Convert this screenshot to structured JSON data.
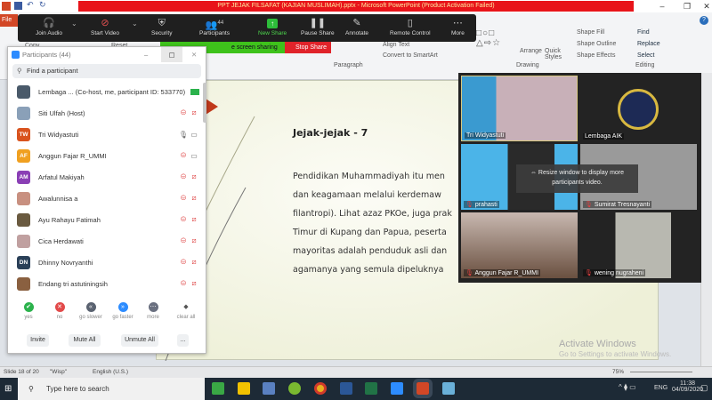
{
  "window": {
    "title": "PPT JEJAK FILSAFAT (KAJIAN MUSLIMAH).pptx - Microsoft PowerPoint (Product Activation Failed)",
    "file_tab": "File"
  },
  "ribbon": {
    "paragraph_label": "Paragraph",
    "drawing_label": "Drawing",
    "editing_label": "Editing",
    "align_text": "Align Text",
    "convert_smartart": "Convert to SmartArt",
    "arrange": "Arrange",
    "quick_styles": "Quick Styles",
    "shape_fill": "Shape Fill",
    "shape_outline": "Shape Outline",
    "shape_effects": "Shape Effects",
    "find": "Find",
    "replace": "Replace",
    "select": "Select",
    "copy": "Copy",
    "reset": "Reset"
  },
  "zoom_toolbar": {
    "items": [
      {
        "label": "Join Audio",
        "icon": "headphones-icon"
      },
      {
        "label": "Start Video",
        "icon": "video-off-icon"
      },
      {
        "label": "Security",
        "icon": "shield-icon"
      },
      {
        "label": "Participants",
        "icon": "participants-icon",
        "badge": "44"
      },
      {
        "label": "New Share",
        "icon": "share-icon"
      },
      {
        "label": "Pause Share",
        "icon": "pause-icon"
      },
      {
        "label": "Annotate",
        "icon": "pencil-icon"
      },
      {
        "label": "Remote Control",
        "icon": "mouse-icon"
      },
      {
        "label": "More",
        "icon": "more-icon"
      }
    ],
    "sharing_status": "e screen sharing",
    "stop_share": "Stop Share"
  },
  "participants": {
    "title": "Participants (44)",
    "search_placeholder": "Find a participant",
    "list": [
      {
        "name": "Lembaga ... (Co-host, me, participant ID: 533770)",
        "initials": "",
        "color": "#4a5a6a"
      },
      {
        "name": "Siti Ulfah (Host)",
        "initials": "",
        "color": "#8aa0b8"
      },
      {
        "name": "Tri Widyastuti",
        "initials": "TW",
        "color": "#d9531e"
      },
      {
        "name": "Anggun Fajar R_UMMI",
        "initials": "AF",
        "color": "#f0a020"
      },
      {
        "name": "Arfatul Makiyah",
        "initials": "AM",
        "color": "#8a3fb5"
      },
      {
        "name": "Awalunnisa a",
        "initials": "",
        "color": "#c89080"
      },
      {
        "name": "Ayu Rahayu Fatimah",
        "initials": "",
        "color": "#6a5a40"
      },
      {
        "name": "Cica Herdawati",
        "initials": "",
        "color": "#c0a0a0"
      },
      {
        "name": "Dhinny Novryanthi",
        "initials": "DN",
        "color": "#2a4058"
      },
      {
        "name": "Endang  tri astutiningsih",
        "initials": "",
        "color": "#8a6040"
      }
    ],
    "reactions": [
      "yes",
      "no",
      "go slower",
      "go faster",
      "more",
      "clear all"
    ],
    "buttons": {
      "invite": "Invite",
      "mute_all": "Mute All",
      "unmute_all": "Unmute All",
      "more": "..."
    }
  },
  "slide": {
    "title": "Jejak-jejak - 7",
    "lines": [
      "Pendidikan Muhammadiyah itu men",
      "dan keagamaan melalui kerdemaw",
      "filantropi).  Lihat azaz PKOe, juga prak",
      "Timur di Kupang dan Papua, peserta",
      "mayoritas adalah penduduk asli dan",
      "agamanya yang semula dipeluknya"
    ]
  },
  "gallery": {
    "tiles": [
      "Tri Widyastuti",
      "Lembaga AIK",
      "prahasti",
      "Sumirat Tresnayanti",
      "Anggun Fajar R_UMMI",
      "wening nugraheni"
    ],
    "tip": "Resize window to display more participants video."
  },
  "watermark": {
    "line1": "Activate Windows",
    "line2": "Go to Settings to activate Windows."
  },
  "statusbar": {
    "slide": "Slide 18 of 20",
    "theme": "\"Wisp\"",
    "language": "English (U.S.)",
    "zoom": "75%"
  },
  "taskbar": {
    "search_placeholder": "Type here to search",
    "lang": "ENG",
    "time": "11:38",
    "date": "04/09/2020"
  }
}
